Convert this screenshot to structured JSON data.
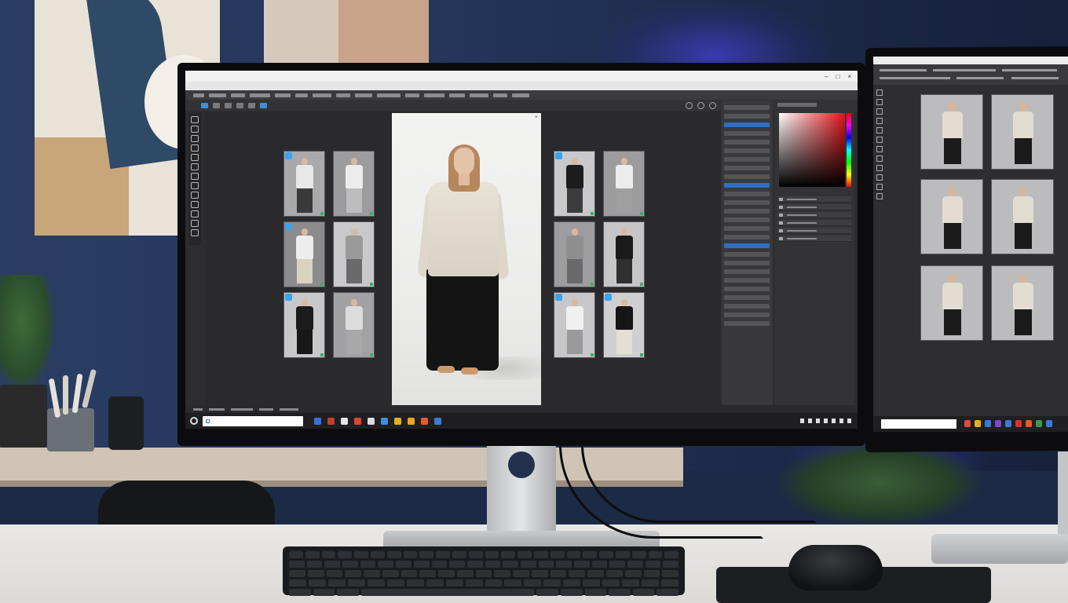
{
  "scene": {
    "description_colors": {
      "wall": "#24365a",
      "accent_glow": "#5046ff",
      "desk": "#e9e8e6"
    }
  },
  "main_monitor": {
    "app": {
      "accent": "#38a4ef",
      "selection": "#2f6fc4"
    },
    "thumbnail_grid_left": [
      {
        "badge": true,
        "top": "#e8e8e8",
        "bottom": "#3a3a3a",
        "bg": "#a9a9ab"
      },
      {
        "badge": false,
        "top": "#ececec",
        "bottom": "#bdbdbd",
        "bg": "#9c9c9e"
      },
      {
        "badge": true,
        "top": "#ededed",
        "bottom": "#d9d2bd",
        "bg": "#8c8c8e"
      },
      {
        "badge": false,
        "top": "#9a9a9a",
        "bottom": "#6a6a6a",
        "bg": "#c9c9cb"
      },
      {
        "badge": true,
        "top": "#1c1c1c",
        "bottom": "#181818",
        "bg": "#c8c8ca"
      },
      {
        "badge": false,
        "top": "#dcdcdc",
        "bottom": "#a8a8a8",
        "bg": "#a2a2a4"
      }
    ],
    "thumbnail_grid_right": [
      {
        "badge": true,
        "top": "#1d1d1d",
        "bottom": "#3c3c3c",
        "bg": "#c9c9cb"
      },
      {
        "badge": false,
        "top": "#ececec",
        "bottom": "#a0a0a0",
        "bg": "#9c9c9e"
      },
      {
        "badge": false,
        "top": "#8e8e8e",
        "bottom": "#6a6a6a",
        "bg": "#9d9d9f"
      },
      {
        "badge": false,
        "top": "#1a1a1a",
        "bottom": "#303030",
        "bg": "#c6c6c8"
      },
      {
        "badge": true,
        "top": "#f0f0f0",
        "bottom": "#9a9a9a",
        "bg": "#c7c7c9"
      },
      {
        "badge": true,
        "top": "#151515",
        "bottom": "#e3dfd4",
        "bg": "#cfcfd1"
      }
    ],
    "featured_photo": {
      "top_color": "#e7e2d6",
      "skirt_color": "#141414"
    },
    "taskbar_apps": [
      "#3b6fd8",
      "#c93a2d",
      "#e6e6e6",
      "#e2442f",
      "#dddddd",
      "#3d8fdc",
      "#e3b020",
      "#f0a31d",
      "#e9572b",
      "#3a7bd5"
    ]
  },
  "right_monitor": {
    "thumbnails": 6,
    "taskbar_apps": [
      "#e24a3a",
      "#e3b020",
      "#3a7bd5",
      "#7b46d6",
      "#3a7bd5",
      "#d9322b",
      "#e9572b",
      "#3a9a4a",
      "#3a7bd5"
    ]
  }
}
